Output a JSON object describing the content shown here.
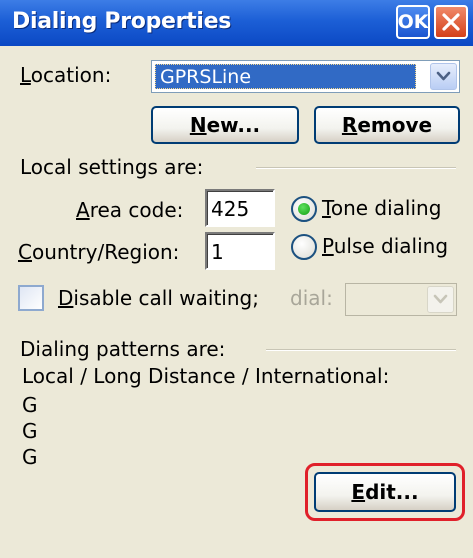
{
  "window": {
    "title": "Dialing Properties",
    "ok_label": "OK",
    "close_icon": "close-icon"
  },
  "location": {
    "label_prefix": "",
    "label_u": "L",
    "label_rest": "ocation:",
    "selected": "GPRSLine"
  },
  "buttons": {
    "new_u": "N",
    "new_rest": "ew...",
    "remove_u": "R",
    "remove_rest": "emove",
    "edit_u": "E",
    "edit_rest": "dit..."
  },
  "local": {
    "heading": "Local settings are:",
    "area_code_u": "A",
    "area_code_rest": "rea code:",
    "area_code_value": "425",
    "country_u": "C",
    "country_rest": "ountry/Region:",
    "country_value": "1",
    "tone_u": "T",
    "tone_rest": "one dialing",
    "pulse_u": "P",
    "pulse_rest": "ulse dialing",
    "tone_selected": true
  },
  "call_waiting": {
    "label_u": "D",
    "label_rest": "isable call waiting;",
    "dial_label": "dial:",
    "checked": false,
    "dial_value": ""
  },
  "patterns": {
    "heading": "Dialing patterns are:",
    "columns": "Local / Long Distance / International:",
    "values": [
      "G",
      "G",
      "G"
    ]
  },
  "colors": {
    "titlebar": "#0b48c4",
    "selection": "#316ac5",
    "highlight_border": "#e0202a"
  }
}
